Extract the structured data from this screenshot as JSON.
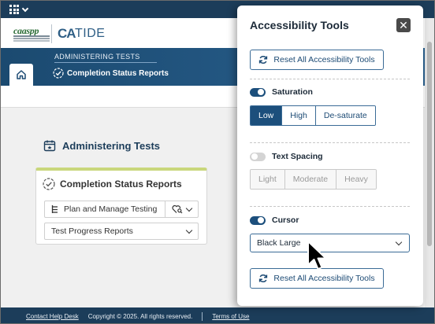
{
  "brand": {
    "program_logo_text": "caaspp",
    "ca_logo_text": "CA",
    "app_title": "TIDE"
  },
  "header": {
    "breadcrumb_parent": "ADMINISTERING TESTS",
    "breadcrumb_current": "Completion Status Reports"
  },
  "main": {
    "section_title": "Administering Tests",
    "card": {
      "title": "Completion Status Reports",
      "rows": [
        {
          "label": "Plan and Manage Testing"
        },
        {
          "label": "Test Progress Reports"
        }
      ]
    }
  },
  "footer": {
    "help_link": "Contact Help Desk",
    "copyright": "Copyright © 2025. All rights reserved.",
    "terms_link": "Terms of Use"
  },
  "panel": {
    "title": "Accessibility Tools",
    "close_symbol": "✕",
    "reset_label": "Reset All Accessibility Tools",
    "saturation": {
      "label": "Saturation",
      "enabled": true,
      "options": [
        "Low",
        "High",
        "De-saturate"
      ],
      "selected": "Low"
    },
    "text_spacing": {
      "label": "Text Spacing",
      "enabled": false,
      "options": [
        "Light",
        "Moderate",
        "Heavy"
      ]
    },
    "cursor": {
      "label": "Cursor",
      "enabled": true,
      "selected_value": "Black Large"
    }
  },
  "colors": {
    "navy": "#1c3d5a",
    "accent_blue": "#1c4f7c",
    "card_accent": "#c9d77c",
    "logo_green": "#2a6b35"
  },
  "icons": [
    "apps-grid-icon",
    "chevron-down-icon",
    "home-icon",
    "check-circle-icon",
    "calendar-icon",
    "list-icon",
    "heart-search-icon",
    "refresh-icon",
    "close-icon",
    "mouse-pointer-icon"
  ]
}
